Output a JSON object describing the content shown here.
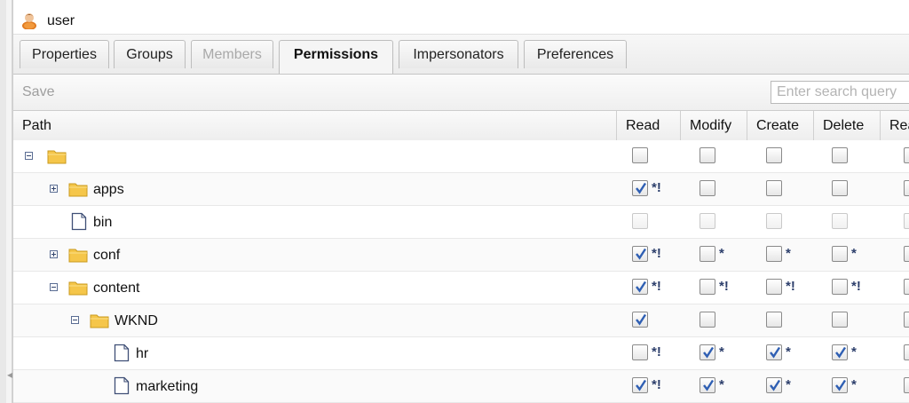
{
  "window": {
    "title": "user"
  },
  "tabs": [
    {
      "label": "Properties",
      "state": "normal"
    },
    {
      "label": "Groups",
      "state": "normal"
    },
    {
      "label": "Members",
      "state": "disabled"
    },
    {
      "label": "Permissions",
      "state": "active"
    },
    {
      "label": "Impersonators",
      "state": "normal"
    },
    {
      "label": "Preferences",
      "state": "normal"
    }
  ],
  "toolbar": {
    "save_label": "Save",
    "search_placeholder": "Enter search query"
  },
  "columns": [
    "Path",
    "Read",
    "Modify",
    "Create",
    "Delete",
    "Rea"
  ],
  "rows": [
    {
      "label": "",
      "type": "folder",
      "depth": 0,
      "expander": "minus",
      "perms": [
        {
          "checked": false,
          "mark": ""
        },
        {
          "checked": false,
          "mark": ""
        },
        {
          "checked": false,
          "mark": ""
        },
        {
          "checked": false,
          "mark": ""
        }
      ]
    },
    {
      "label": "apps",
      "type": "folder",
      "depth": 1,
      "expander": "plus",
      "perms": [
        {
          "checked": true,
          "mark": "*!"
        },
        {
          "checked": false,
          "mark": ""
        },
        {
          "checked": false,
          "mark": ""
        },
        {
          "checked": false,
          "mark": ""
        }
      ]
    },
    {
      "label": "bin",
      "type": "file",
      "depth": 1,
      "expander": "none",
      "disabled": true,
      "perms": [
        {
          "checked": false,
          "mark": ""
        },
        {
          "checked": false,
          "mark": ""
        },
        {
          "checked": false,
          "mark": ""
        },
        {
          "checked": false,
          "mark": ""
        }
      ]
    },
    {
      "label": "conf",
      "type": "folder",
      "depth": 1,
      "expander": "plus",
      "perms": [
        {
          "checked": true,
          "mark": "*!"
        },
        {
          "checked": false,
          "mark": "*"
        },
        {
          "checked": false,
          "mark": "*"
        },
        {
          "checked": false,
          "mark": "*"
        }
      ]
    },
    {
      "label": "content",
      "type": "folder",
      "depth": 1,
      "expander": "minus",
      "perms": [
        {
          "checked": true,
          "mark": "*!"
        },
        {
          "checked": false,
          "mark": "*!"
        },
        {
          "checked": false,
          "mark": "*!"
        },
        {
          "checked": false,
          "mark": "*!"
        }
      ]
    },
    {
      "label": "WKND",
      "type": "folder",
      "depth": 2,
      "expander": "minus",
      "perms": [
        {
          "checked": true,
          "mark": ""
        },
        {
          "checked": false,
          "mark": ""
        },
        {
          "checked": false,
          "mark": ""
        },
        {
          "checked": false,
          "mark": ""
        }
      ]
    },
    {
      "label": "hr",
      "type": "file",
      "depth": 3,
      "expander": "none",
      "perms": [
        {
          "checked": false,
          "mark": "*!"
        },
        {
          "checked": true,
          "mark": "*"
        },
        {
          "checked": true,
          "mark": "*"
        },
        {
          "checked": true,
          "mark": "*"
        }
      ]
    },
    {
      "label": "marketing",
      "type": "file",
      "depth": 3,
      "expander": "none",
      "perms": [
        {
          "checked": true,
          "mark": "*!"
        },
        {
          "checked": true,
          "mark": "*"
        },
        {
          "checked": true,
          "mark": "*"
        },
        {
          "checked": true,
          "mark": "*"
        }
      ]
    }
  ],
  "icons": {
    "title": "user-icon",
    "folder": "folder-icon",
    "file": "file-icon",
    "check": "checkmark-icon"
  },
  "colors": {
    "folder": "#f5c64a",
    "check": "#2f5fb3",
    "mark": "#2c3e6b"
  }
}
